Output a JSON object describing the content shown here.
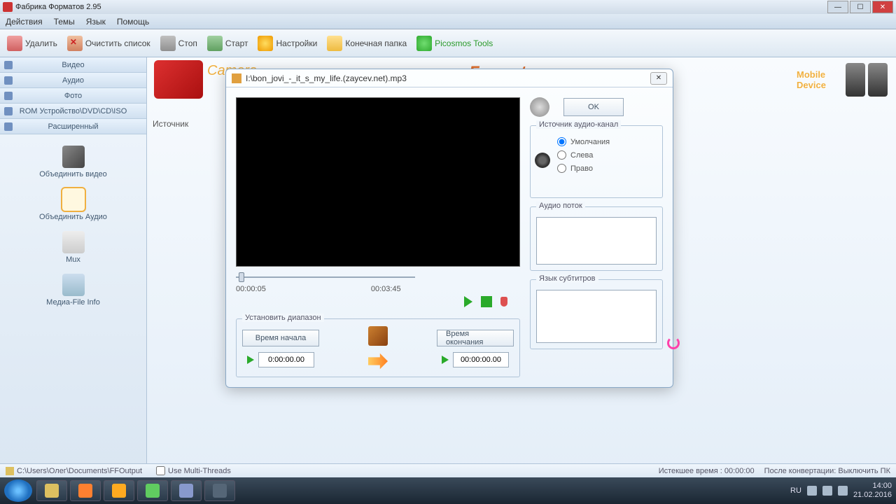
{
  "titlebar": {
    "text": "Фабрика Форматов 2.95"
  },
  "menu": {
    "actions": "Действия",
    "themes": "Темы",
    "lang": "Язык",
    "help": "Помощь"
  },
  "toolbar": {
    "delete": "Удалить",
    "clear": "Очистить список",
    "stop": "Стоп",
    "start": "Старт",
    "settings": "Настройки",
    "outfolder": "Конечная папка",
    "picosmos": "Picosmos Tools"
  },
  "sidebar": {
    "cats": {
      "video": "Видео",
      "audio": "Аудио",
      "photo": "Фото",
      "rom": "ROM Устройство\\DVD\\CD\\ISO",
      "adv": "Расширенный"
    },
    "tools": {
      "joinv": "Объединить видео",
      "joina": "Объединить Аудио",
      "mux": "Mux",
      "info": "Медиа-File Info"
    }
  },
  "content": {
    "src": "Источник",
    "camera": "Camera",
    "format": "Format",
    "mobile": "Mobile Device"
  },
  "dialog": {
    "title": "I:\\bon_jovi_-_it_s_my_life.(zaycev.net).mp3",
    "ok": "OK",
    "t_start": "00:00:05",
    "t_end": "00:03:45",
    "range": {
      "legend": "Установить диапазон",
      "startbtn": "Время начала",
      "endbtn": "Время окончания",
      "startval": "0:00:00.00",
      "endval": "00:00:00.00"
    },
    "audio_src": {
      "legend": "Источник аудио-канал",
      "def": "Умолчания",
      "left": "Слева",
      "right": "Право"
    },
    "audio_stream": {
      "legend": "Аудио поток"
    },
    "sub_lang": {
      "legend": "Язык субтитров"
    }
  },
  "status": {
    "path": "C:\\Users\\Олег\\Documents\\FFOutput",
    "multi": "Use Multi-Threads",
    "elapsed_lbl": "Истекшее время : ",
    "elapsed": "00:00:00",
    "after_lbl": "После конвертации: ",
    "after": "Выключить ПК"
  },
  "tray": {
    "lang": "RU",
    "time": "14:00",
    "date": "21.02.2016"
  }
}
